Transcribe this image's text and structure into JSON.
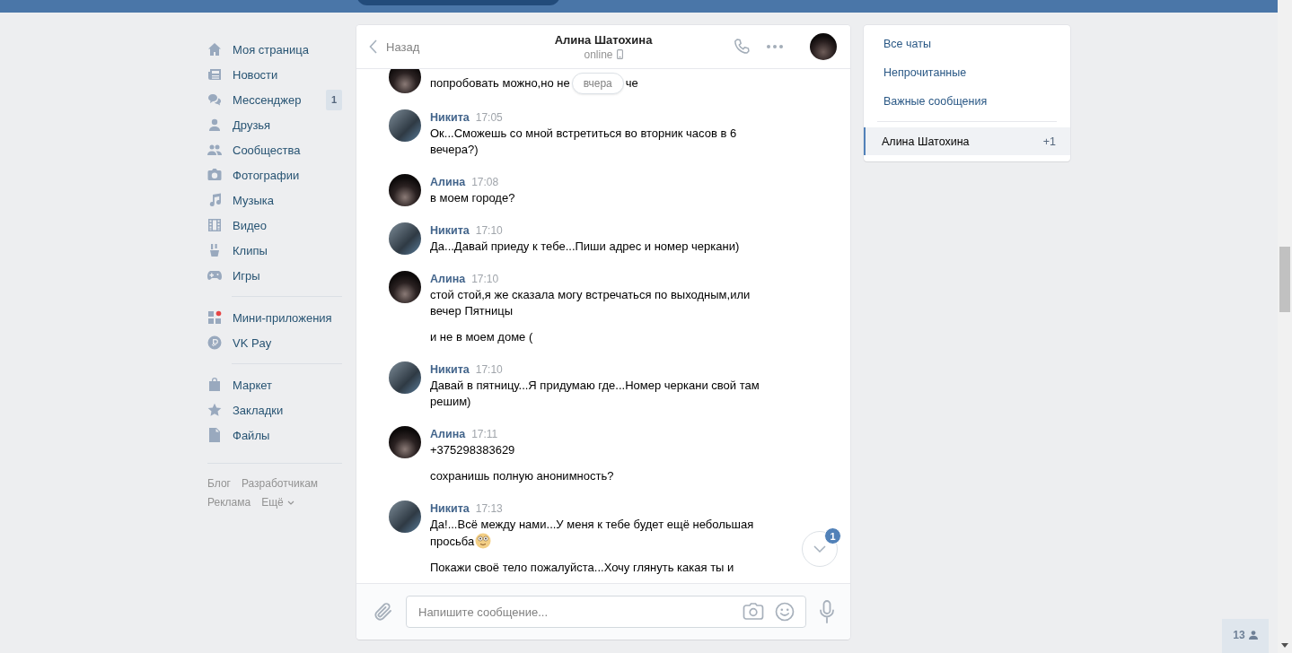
{
  "nav": {
    "sections": [
      [
        {
          "label": "Моя страница"
        },
        {
          "label": "Новости"
        },
        {
          "label": "Мессенджер",
          "badge": "1"
        },
        {
          "label": "Друзья"
        },
        {
          "label": "Сообщества"
        },
        {
          "label": "Фотографии"
        },
        {
          "label": "Музыка"
        },
        {
          "label": "Видео"
        },
        {
          "label": "Клипы"
        },
        {
          "label": "Игры"
        }
      ],
      [
        {
          "label": "Мини-приложения"
        },
        {
          "label": "VK Pay"
        }
      ],
      [
        {
          "label": "Маркет"
        },
        {
          "label": "Закладки"
        },
        {
          "label": "Файлы"
        }
      ]
    ],
    "footer_links": [
      "Блог",
      "Разработчикам",
      "Реклама",
      "Ещё"
    ]
  },
  "chat": {
    "back": "Назад",
    "title": "Алина Шатохина",
    "status": "online",
    "messages": [
      {
        "kind": "contact",
        "date_label": "вчера",
        "texts": [
          {
            "text": "попробовать можно,но не",
            "emoji": false
          },
          {
            "text": "че",
            "emoji": false
          }
        ]
      },
      {
        "kind": "self",
        "author": "Никита",
        "time": "17:05",
        "texts": [
          {
            "text": "Ок...Сможешь со мной встретиться во вторник часов в 6 вечера?)",
            "emoji": false
          }
        ]
      },
      {
        "kind": "contact",
        "author": "Алина",
        "time": "17:08",
        "texts": [
          {
            "text": "в моем городе?",
            "emoji": false
          }
        ]
      },
      {
        "kind": "self",
        "author": "Никита",
        "time": "17:10",
        "texts": [
          {
            "text": "Да...Давай приеду к тебе...Пиши адрес и номер черкани)",
            "emoji": false
          }
        ]
      },
      {
        "kind": "contact",
        "author": "Алина",
        "time": "17:10",
        "texts": [
          {
            "text": "стой стой,я же сказала могу встречаться по выходным,или вечер Пятницы",
            "emoji": false
          },
          {
            "text": "и не в моем доме (",
            "emoji": false
          }
        ]
      },
      {
        "kind": "self",
        "author": "Никита",
        "time": "17:10",
        "texts": [
          {
            "text": "Давай в пятницу...Я придумаю где...Номер черкани свой там решим)",
            "emoji": false
          }
        ]
      },
      {
        "kind": "contact",
        "author": "Алина",
        "time": "17:11",
        "texts": [
          {
            "text": "+375298383629",
            "emoji": false
          },
          {
            "text": "сохранишь полную анонимность?",
            "emoji": false
          }
        ]
      },
      {
        "kind": "self",
        "author": "Никита",
        "time": "17:13",
        "texts": [
          {
            "text": "Да!...Всё между нами...У меня к тебе будет ещё небольшая просьба",
            "emoji": true
          },
          {
            "text": "Покажи своё тело пожалуйста...Хочу глянуть какая ты и",
            "emoji": false
          }
        ]
      }
    ],
    "scroll_badge": "1",
    "composer": {
      "placeholder": "Напишите сообщение..."
    }
  },
  "right_panel": {
    "filters": [
      {
        "label": "Все чаты",
        "selected": false
      },
      {
        "label": "Непрочитанные",
        "selected": false
      },
      {
        "label": "Важные сообщения",
        "selected": false
      }
    ],
    "chats": [
      {
        "name": "Алина Шатохина",
        "count": "+1",
        "selected": true
      }
    ]
  },
  "online_friends": {
    "count": "13"
  }
}
